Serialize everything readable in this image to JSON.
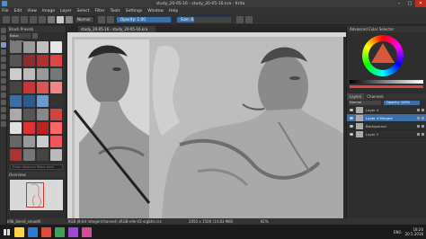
{
  "window": {
    "title": "study_20-05-16 - study_20-05-16.kra - Krita",
    "buttons": [
      "–",
      "□",
      "✕"
    ]
  },
  "menu": [
    "File",
    "Edit",
    "View",
    "Image",
    "Layer",
    "Select",
    "Filter",
    "Tools",
    "Settings",
    "Window",
    "Help"
  ],
  "toolbar": {
    "blend_mode": "Normal",
    "opacity": {
      "label": "Opacity: 1.00",
      "value": 1.0
    },
    "size": {
      "label": "Size: 8.84 px",
      "value": 0.32
    }
  },
  "brush_dock": {
    "title": "Brush Presets",
    "tag": "Basic Brushes",
    "search_placeholder": "Enter resource filters here",
    "overview_title": "Overview",
    "preset_colors": [
      "#7a7a7a",
      "#9a9a9a",
      "#c0c0c0",
      "#e6e6e6",
      "#555",
      "#8c2e2e",
      "#b03030",
      "#dd4444",
      "#cccccc",
      "#bbbbbb",
      "#999",
      "#777",
      "#444",
      "#c33",
      "#d55",
      "#e88",
      "#3a6ea8",
      "#2d5a8c",
      "#6b9bd1",
      "#333",
      "#aaa",
      "#555",
      "#888",
      "#c44",
      "#e0e0e0",
      "#d33",
      "#b22",
      "#f66",
      "#666",
      "#999",
      "#ccc",
      "#e55",
      "#a33",
      "#777",
      "#444",
      "#bbb"
    ]
  },
  "canvas_tab": "study_20-05-16 - study_20-05-16.kra",
  "status": {
    "brush": "k9b_blend_smooth",
    "colorspace": "RGB (8-bit integer/channel)  sRGB-elle-V2-srgbtrc.icc",
    "size": "2050 x 1500 (14.83 MiB)",
    "zoom": "92%"
  },
  "right_dock": {
    "color_title": "Advanced Color Selector",
    "tabs": [
      "Layers",
      "Channels"
    ],
    "layer_blend": "Normal",
    "layer_opacity": "Opacity: 100%",
    "layers": [
      {
        "name": "Layer 4",
        "active": false
      },
      {
        "name": "Layer 4 Merged",
        "active": true
      },
      {
        "name": "Background",
        "active": false
      },
      {
        "name": "Layer 2",
        "active": false
      }
    ]
  },
  "taskbar": {
    "time": "18:20",
    "date": "20.5.2016",
    "lang": "ENG",
    "apps": [
      "#ffd24a",
      "#2e7bd6",
      "#e04a3a",
      "#3aa35a",
      "#9a4ad6",
      "#d64a9a"
    ]
  }
}
